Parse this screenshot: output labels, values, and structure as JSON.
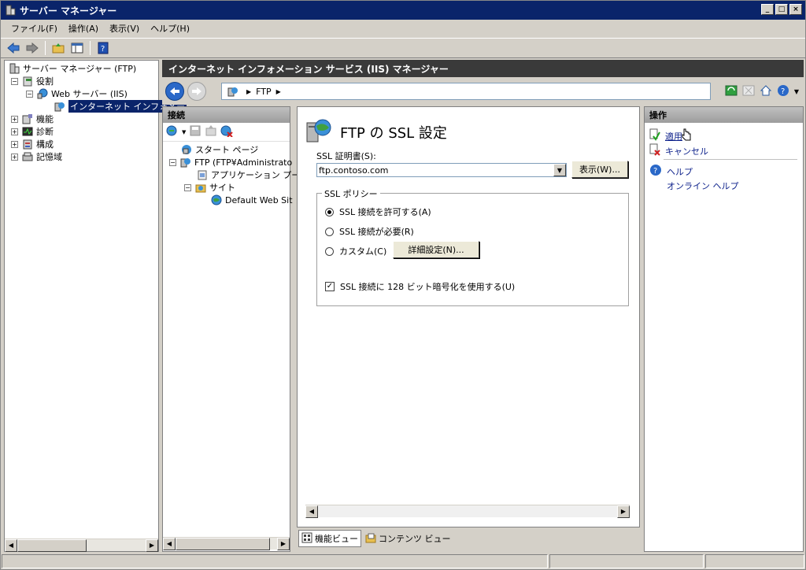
{
  "window": {
    "title": "サーバー マネージャー",
    "controls": [
      "_",
      "□",
      "×"
    ]
  },
  "menu": [
    "ファイル(F)",
    "操作(A)",
    "表示(V)",
    "ヘルプ(H)"
  ],
  "tree": {
    "root": "サーバー マネージャー (FTP)",
    "roles": "役割",
    "web_server": "Web サーバー (IIS)",
    "iis_manager": "インターネット インフォメー",
    "features": "機能",
    "diagnostics": "診断",
    "configuration": "構成",
    "storage": "記憶域"
  },
  "iis": {
    "header": "インターネット インフォメーション サービス (IIS) マネージャー",
    "address": {
      "segment": "FTP"
    }
  },
  "connections": {
    "title": "接続",
    "start_page": "スタート ページ",
    "server": "FTP (FTP¥Administrato",
    "app_pools": "アプリケーション プール",
    "sites": "サイト",
    "default_site": "Default Web Sit"
  },
  "feature": {
    "title": "FTP の SSL 設定",
    "cert_label": "SSL 証明書(S):",
    "cert_value": "ftp.contoso.com",
    "view_button": "表示(W)...",
    "policy_legend": "SSL ポリシー",
    "options": [
      {
        "label": "SSL 接続を許可する(A)",
        "selected": true
      },
      {
        "label": "SSL 接続が必要(R)",
        "selected": false
      },
      {
        "label": "カスタム(C)",
        "selected": false
      }
    ],
    "advanced_button": "詳細設定(N)...",
    "use128_label": "SSL 接続に 128 ビット暗号化を使用する(U)",
    "use128_checked": true
  },
  "view_tabs": {
    "features": "機能ビュー",
    "content": "コンテンツ ビュー"
  },
  "actions": {
    "title": "操作",
    "apply": "適用",
    "cancel": "キャンセル",
    "help": "ヘルプ",
    "online_help": "オンライン ヘルプ"
  },
  "colors": {
    "titlebar": "#0a246a",
    "iis_header": "#3a3a3a",
    "selection": "#0a246a"
  }
}
